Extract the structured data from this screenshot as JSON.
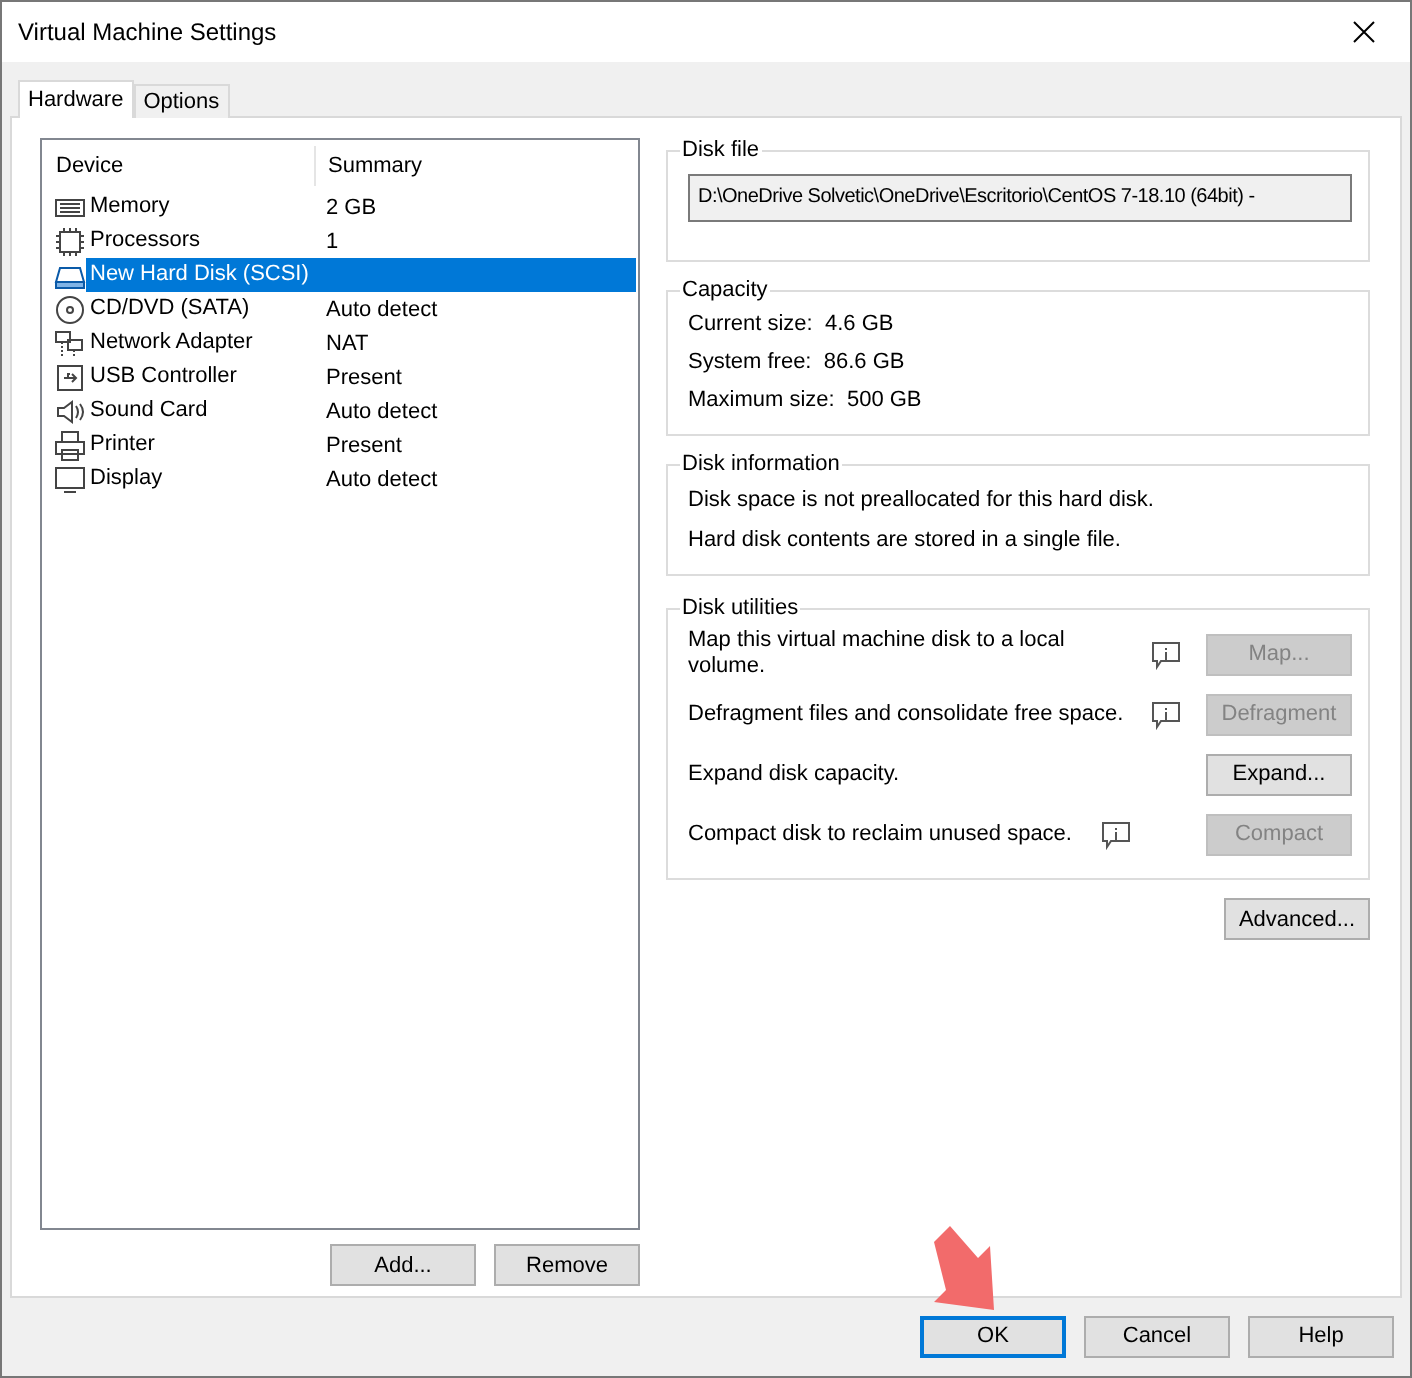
{
  "window": {
    "title": "Virtual Machine Settings"
  },
  "tabs": [
    {
      "label": "Hardware",
      "selected": true
    },
    {
      "label": "Options",
      "selected": false
    }
  ],
  "device_list": {
    "columns": [
      "Device",
      "Summary"
    ],
    "rows": [
      {
        "kind": "memory",
        "device": "Memory",
        "summary": "2 GB",
        "selected": false
      },
      {
        "kind": "processor",
        "device": "Processors",
        "summary": "1",
        "selected": false
      },
      {
        "kind": "disk",
        "device": "New Hard Disk (SCSI)",
        "selected": true
      },
      {
        "kind": "cd",
        "device": "CD/DVD (SATA)",
        "summary": "Auto detect",
        "selected": false
      },
      {
        "kind": "network",
        "device": "Network Adapter",
        "summary": "NAT",
        "selected": false
      },
      {
        "kind": "usb",
        "device": "USB Controller",
        "summary": "Present",
        "selected": false
      },
      {
        "kind": "sound",
        "device": "Sound Card",
        "summary": "Auto detect",
        "selected": false
      },
      {
        "kind": "printer",
        "device": "Printer",
        "summary": "Present",
        "selected": false
      },
      {
        "kind": "display",
        "device": "Display",
        "summary": "Auto detect",
        "selected": false
      }
    ]
  },
  "list_buttons": [
    {
      "label": "Add...",
      "disabled": false
    },
    {
      "label": "Remove",
      "disabled": false
    }
  ],
  "disk_file": {
    "title": "Disk file",
    "value": "D:\\OneDrive Solvetic\\OneDrive\\Escritorio\\CentOS 7-18.10 (64bit) -"
  },
  "capacity": {
    "title": "Capacity",
    "lines": [
      "Current size:  4.6 GB",
      "System free:  86.6 GB",
      "Maximum size:  500 GB"
    ]
  },
  "disk_information": {
    "title": "Disk information",
    "lines": [
      "Disk space is not preallocated for this hard disk.",
      "Hard disk contents are stored in a single file."
    ]
  },
  "disk_utilities": {
    "title": "Disk utilities",
    "items": [
      {
        "text": "Map this virtual machine disk to a local volume.",
        "info": true,
        "info_inline": false,
        "button": "Map...",
        "disabled": true
      },
      {
        "text": "Defragment files and consolidate free space.",
        "info": true,
        "info_inline": false,
        "button": "Defragment",
        "disabled": true
      },
      {
        "text": "Expand disk capacity.",
        "info": false,
        "info_inline": false,
        "button": "Expand...",
        "disabled": false
      },
      {
        "text": "Compact disk to reclaim unused space.",
        "info": true,
        "info_inline": true,
        "button": "Compact",
        "disabled": true
      }
    ]
  },
  "advanced_button": {
    "label": "Advanced...",
    "disabled": false
  },
  "dialog_buttons": [
    {
      "label": "OK",
      "default": true,
      "disabled": false
    },
    {
      "label": "Cancel",
      "default": false,
      "disabled": false
    },
    {
      "label": "Help",
      "default": false,
      "disabled": false
    }
  ]
}
